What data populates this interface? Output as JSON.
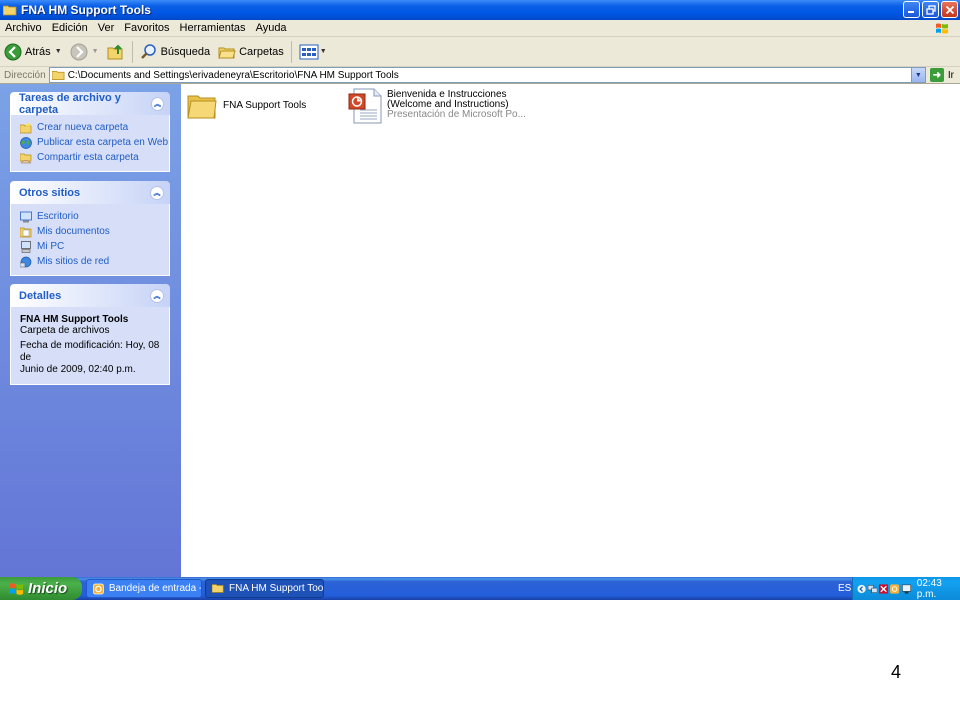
{
  "window": {
    "title": "FNA HM Support Tools"
  },
  "menu": [
    "Archivo",
    "Edición",
    "Ver",
    "Favoritos",
    "Herramientas",
    "Ayuda"
  ],
  "toolbar": {
    "back_label": "Atrás",
    "search_label": "Búsqueda",
    "folders_label": "Carpetas"
  },
  "address": {
    "label": "Dirección",
    "value": "C:\\Documents and Settings\\erivadeneyra\\Escritorio\\FNA HM Support Tools",
    "go_label": "Ir"
  },
  "panels": {
    "tasks": {
      "title": "Tareas de archivo y carpeta",
      "items": [
        {
          "label": "Crear nueva carpeta",
          "icon": "new-folder-icon"
        },
        {
          "label": "Publicar esta carpeta en Web",
          "icon": "web-globe-icon"
        },
        {
          "label": "Compartir esta carpeta",
          "icon": "share-folder-icon"
        }
      ]
    },
    "places": {
      "title": "Otros sitios",
      "items": [
        {
          "label": "Escritorio",
          "icon": "desktop-icon"
        },
        {
          "label": "Mis documentos",
          "icon": "my-documents-icon"
        },
        {
          "label": "Mi PC",
          "icon": "my-computer-icon"
        },
        {
          "label": "Mis sitios de red",
          "icon": "network-icon"
        }
      ]
    },
    "details": {
      "title": "Detalles",
      "name": "FNA HM Support Tools",
      "type": "Carpeta de archivos",
      "modified_line1": "Fecha de modificación: Hoy, 08 de",
      "modified_line2": "Junio de 2009, 02:40 p.m."
    }
  },
  "files": [
    {
      "name": "FNA Support Tools",
      "icon": "folder-icon"
    },
    {
      "name_line1": "Bienvenida e Instrucciones",
      "name_line2": "(Welcome and Instructions)",
      "type": "Presentación de Microsoft Po...",
      "icon": "powerpoint-icon"
    }
  ],
  "taskbar": {
    "start_label": "Inicio",
    "buttons": [
      {
        "label": "Bandeja de entrada -...",
        "active": false
      },
      {
        "label": "FNA HM Support Tools",
        "active": true
      }
    ],
    "language": "ES",
    "clock": "02:43 p.m."
  },
  "page_number": "4"
}
